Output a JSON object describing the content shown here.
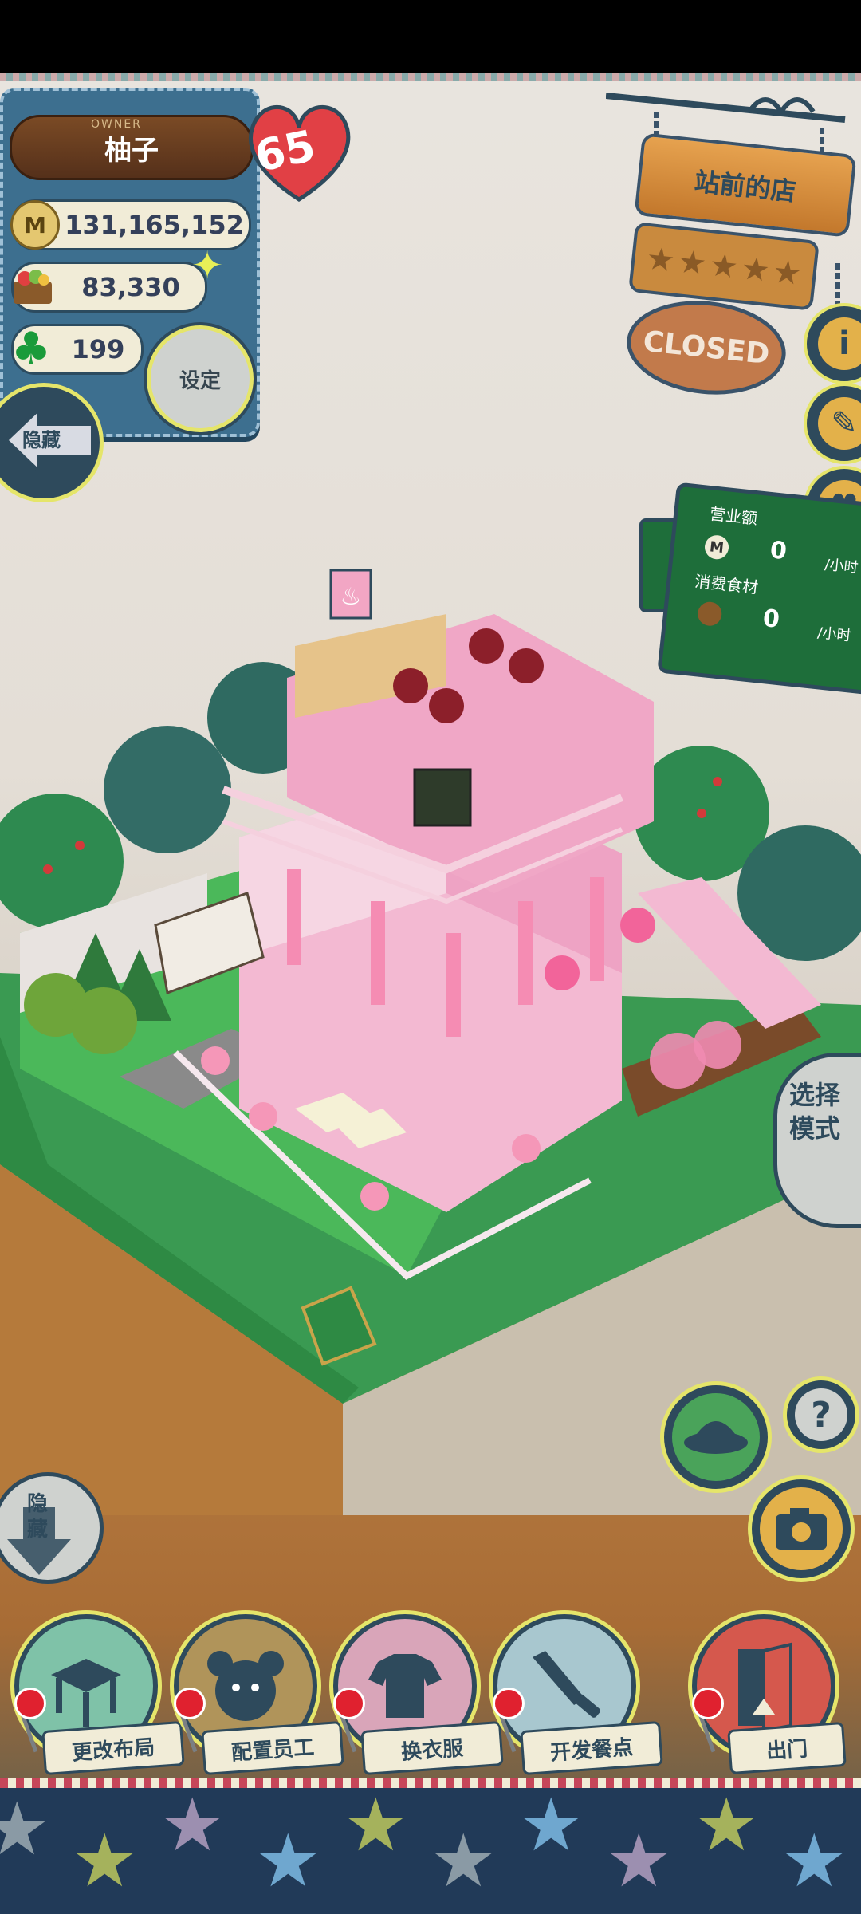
{
  "owner": {
    "caption": "OWNER",
    "name": "柚子",
    "level": "65"
  },
  "stats": {
    "coin_icon": "M",
    "money": "131,165,152",
    "ingredients": "83,330",
    "clovers": "199"
  },
  "buttons": {
    "settings": "设定",
    "hide_top": "隐藏",
    "hide_bottom": "隐藏",
    "mode_select": "选择模式"
  },
  "shop": {
    "name": "站前的店",
    "stars": 5,
    "status": "CLOSED"
  },
  "side_icons": [
    "info-icon",
    "recipe-book-icon",
    "heart-speech-icon"
  ],
  "sales_board": {
    "revenue_label": "营业额",
    "revenue_value": "0",
    "revenue_unit": "/小时",
    "ingredients_label": "消费食材",
    "ingredients_value": "0",
    "ingredients_unit": "/小时",
    "coin_icon": "M"
  },
  "bottom_menu": [
    {
      "label": "更改布局",
      "icon": "table-icon",
      "bg": "#7fc2a8"
    },
    {
      "label": "配置员工",
      "icon": "bear-head-icon",
      "bg": "#b0945a"
    },
    {
      "label": "换衣服",
      "icon": "shirt-icon",
      "bg": "#d9a5b9"
    },
    {
      "label": "开发餐点",
      "icon": "knife-icon",
      "bg": "#a8c7cf"
    },
    {
      "label": "出门",
      "icon": "door-icon",
      "bg": "#d5584d"
    }
  ],
  "tools": {
    "help": "?",
    "camera_icon": "camera-icon",
    "hat_icon": "hat-icon"
  },
  "colors": {
    "denim": "#3d6f8f",
    "navy": "#2e4a5c",
    "accent_yellow": "#e5e56a",
    "heart_red": "#e14045"
  }
}
